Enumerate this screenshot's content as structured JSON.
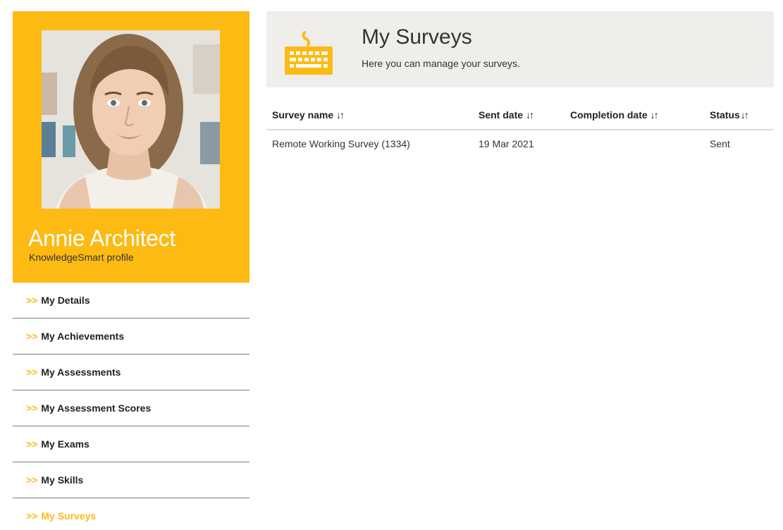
{
  "profile": {
    "name": "Annie Architect",
    "subtitle": "KnowledgeSmart profile"
  },
  "nav": {
    "arrow": ">>",
    "items": [
      {
        "label": "My Details"
      },
      {
        "label": "My Achievements"
      },
      {
        "label": "My Assessments"
      },
      {
        "label": "My Assessment Scores"
      },
      {
        "label": "My Exams"
      },
      {
        "label": "My Skills"
      },
      {
        "label": "My Surveys",
        "active": true
      }
    ]
  },
  "header": {
    "title": "My Surveys",
    "subtitle": "Here you can manage your surveys.",
    "icon": "keyboard-icon"
  },
  "table": {
    "columns": [
      {
        "label": "Survey name"
      },
      {
        "label": "Sent date"
      },
      {
        "label": "Completion date"
      },
      {
        "label": "Status"
      }
    ],
    "sort_glyph": "↓↑",
    "rows": [
      {
        "name": "Remote Working Survey (1334)",
        "sent": "19 Mar 2021",
        "completed": "",
        "status": "Sent"
      }
    ]
  },
  "colors": {
    "accent": "#fdba12",
    "panel": "#efeeeb",
    "text": "#333333"
  }
}
